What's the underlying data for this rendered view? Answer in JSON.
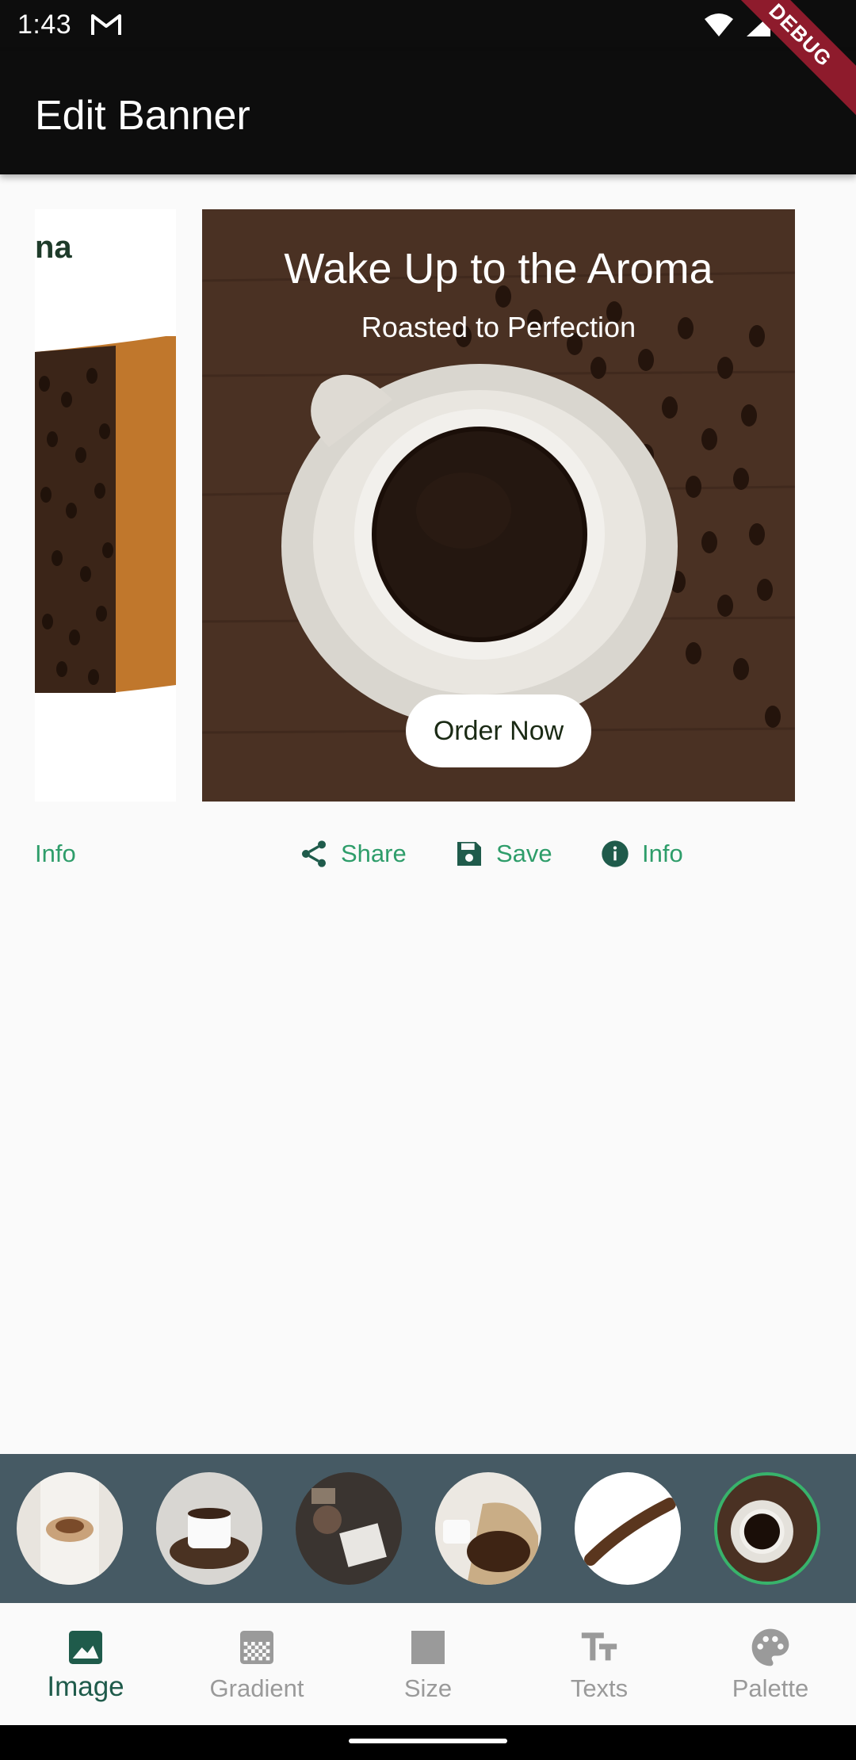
{
  "status_bar": {
    "time": "1:43"
  },
  "debug_banner": "DEBUG",
  "app_bar": {
    "title": "Edit Banner"
  },
  "banners": {
    "previous": {
      "partial_title": "na",
      "partial_action_label": "Info"
    },
    "current": {
      "title": "Wake Up to the Aroma",
      "subtitle": "Roasted to Perfection",
      "button_label": "Order Now"
    }
  },
  "actions": [
    {
      "label": "Share",
      "icon": "share-icon"
    },
    {
      "label": "Save",
      "icon": "save-icon"
    },
    {
      "label": "Info",
      "icon": "info-icon"
    }
  ],
  "image_thumbnails": [
    {
      "name": "hands-holding-coffee"
    },
    {
      "name": "coffee-cup-on-beans"
    },
    {
      "name": "coffee-brewing-tools"
    },
    {
      "name": "coffee-sack-beans"
    },
    {
      "name": "scattered-beans-white"
    },
    {
      "name": "coffee-cup-top-view",
      "selected": true
    }
  ],
  "bottom_nav": [
    {
      "label": "Image",
      "icon": "image-icon",
      "active": true
    },
    {
      "label": "Gradient",
      "icon": "gradient-icon"
    },
    {
      "label": "Size",
      "icon": "size-icon"
    },
    {
      "label": "Texts",
      "icon": "text-fields-icon"
    },
    {
      "label": "Palette",
      "icon": "palette-icon"
    }
  ],
  "colors": {
    "accent": "#2e9d6a",
    "nav_active": "#1f5b4b",
    "thumb_strip_bg": "#465a64",
    "selected_ring": "#38b36b",
    "app_bar": "#0d0d0d"
  }
}
